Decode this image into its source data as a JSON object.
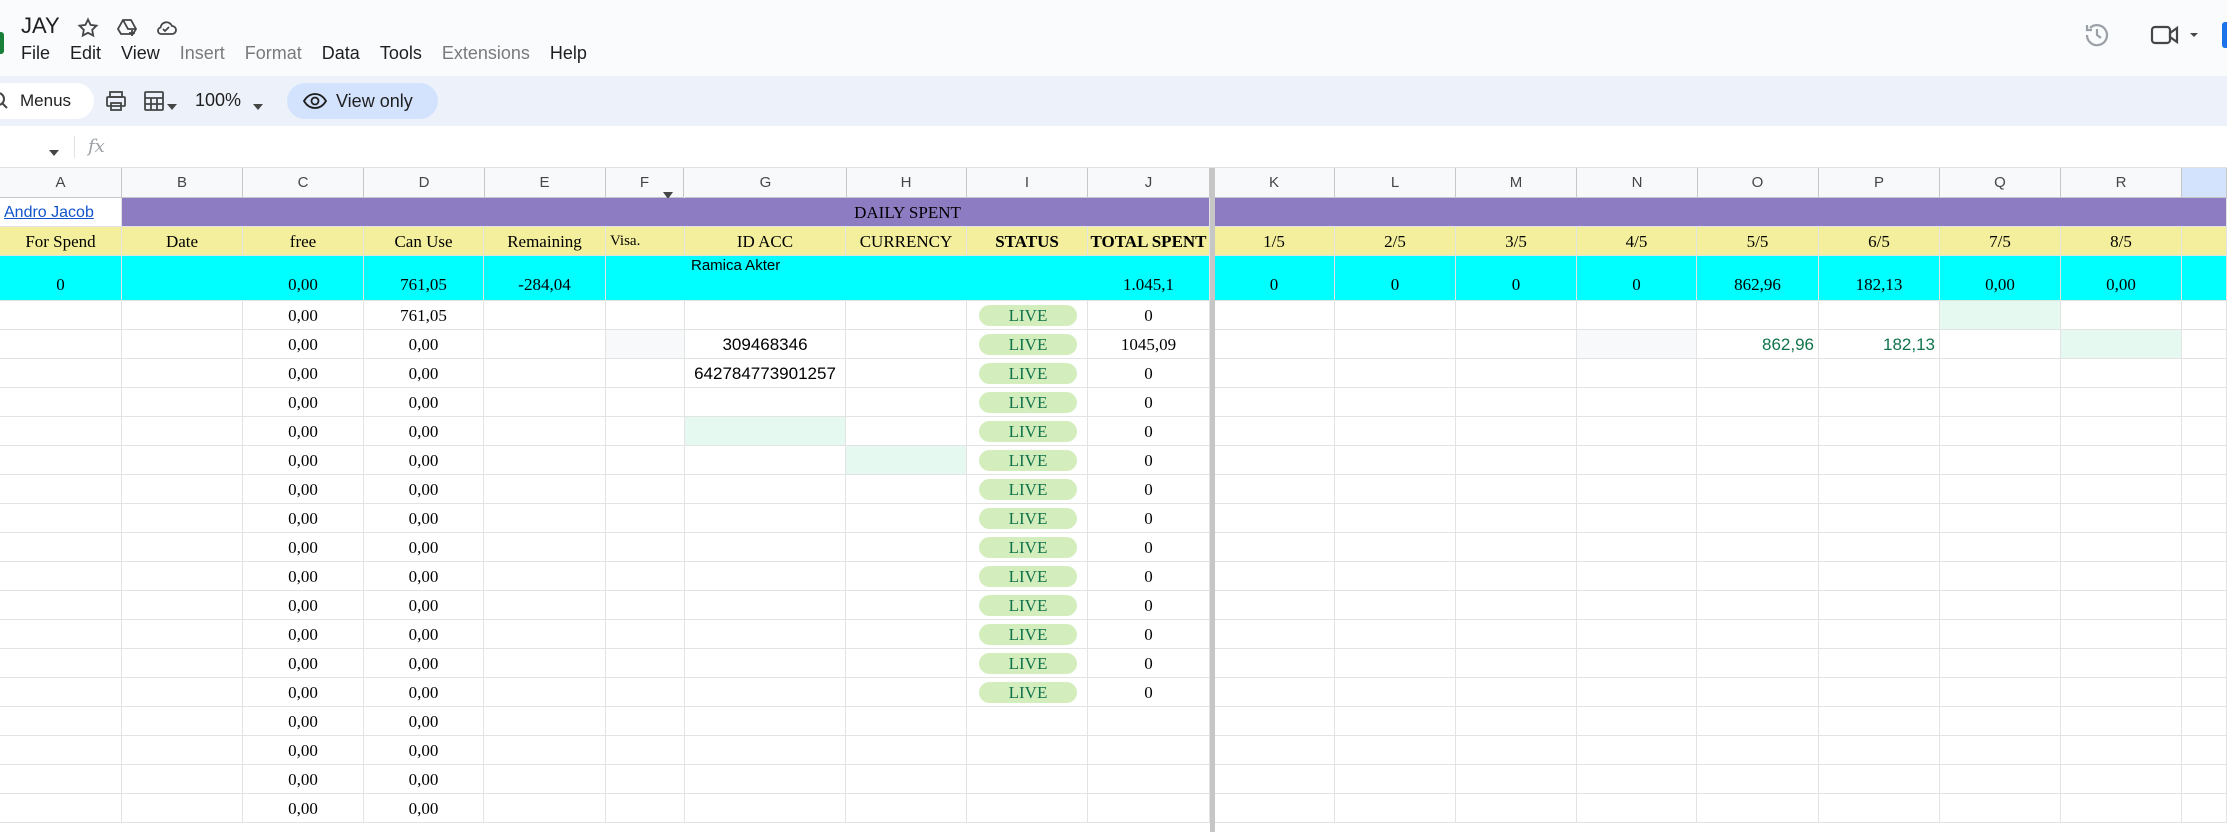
{
  "doc": {
    "title": "JAY"
  },
  "menu": [
    "File",
    "Edit",
    "View",
    "Insert",
    "Format",
    "Data",
    "Tools",
    "Extensions",
    "Help"
  ],
  "menu_disabled": [
    "Insert",
    "Format",
    "Extensions"
  ],
  "toolbar": {
    "menus_label": "Menus",
    "zoom": "100%",
    "view_only": "View only"
  },
  "formula_bar": {
    "fx": "fx"
  },
  "columns": [
    "A",
    "B",
    "C",
    "D",
    "E",
    "F",
    "G",
    "H",
    "I",
    "J",
    "K",
    "L",
    "M",
    "N",
    "O",
    "P",
    "Q",
    "R"
  ],
  "link_cell": "Andro Jacob",
  "banner_title": "DAILY SPENT",
  "headers": {
    "A": "For Spend",
    "B": "Date",
    "C": "free",
    "D": "Can Use",
    "E": "Remaining",
    "F": "Visa.",
    "G": "ID ACC",
    "H": "CURRENCY",
    "I": "STATUS",
    "J": "TOTAL SPENT",
    "K": "1/5",
    "L": "2/5",
    "M": "3/5",
    "N": "4/5",
    "O": "5/5",
    "P": "6/5",
    "Q": "7/5",
    "R": "8/5"
  },
  "summary": {
    "name_note": "Ramica Akter",
    "A": "0",
    "C": "0,00",
    "D": "761,05",
    "E": "-284,04",
    "J": "1.045,1",
    "K": "0",
    "L": "0",
    "M": "0",
    "N": "0",
    "O": "862,96",
    "P": "182,13",
    "Q": "0,00",
    "R": "0,00"
  },
  "rows": [
    {
      "C": "0,00",
      "D": "761,05",
      "G": "",
      "I": "LIVE",
      "J": "0"
    },
    {
      "C": "0,00",
      "D": "0,00",
      "G": "309468346",
      "I": "LIVE",
      "J": "1045,09",
      "O": "862,96",
      "P": "182,13"
    },
    {
      "C": "0,00",
      "D": "0,00",
      "G": "642784773901257",
      "I": "LIVE",
      "J": "0"
    },
    {
      "C": "0,00",
      "D": "0,00",
      "G": "",
      "I": "LIVE",
      "J": "0"
    },
    {
      "C": "0,00",
      "D": "0,00",
      "G": "",
      "I": "LIVE",
      "J": "0"
    },
    {
      "C": "0,00",
      "D": "0,00",
      "G": "",
      "I": "LIVE",
      "J": "0"
    },
    {
      "C": "0,00",
      "D": "0,00",
      "G": "",
      "I": "LIVE",
      "J": "0"
    },
    {
      "C": "0,00",
      "D": "0,00",
      "G": "",
      "I": "LIVE",
      "J": "0"
    },
    {
      "C": "0,00",
      "D": "0,00",
      "G": "",
      "I": "LIVE",
      "J": "0"
    },
    {
      "C": "0,00",
      "D": "0,00",
      "G": "",
      "I": "LIVE",
      "J": "0"
    },
    {
      "C": "0,00",
      "D": "0,00",
      "G": "",
      "I": "LIVE",
      "J": "0"
    },
    {
      "C": "0,00",
      "D": "0,00",
      "G": "",
      "I": "LIVE",
      "J": "0"
    },
    {
      "C": "0,00",
      "D": "0,00",
      "G": "",
      "I": "LIVE",
      "J": "0"
    },
    {
      "C": "0,00",
      "D": "0,00",
      "G": "",
      "I": "LIVE",
      "J": "0"
    },
    {
      "C": "0,00",
      "D": "0,00"
    },
    {
      "C": "0,00",
      "D": "0,00"
    },
    {
      "C": "0,00",
      "D": "0,00"
    },
    {
      "C": "0,00",
      "D": "0,00"
    }
  ],
  "colors": {
    "banner_purple": "#8e7cc3",
    "header_yellow": "#f4ef9c",
    "summary_cyan": "#00ffff",
    "live_pill": "#d4edbc",
    "live_text": "#11734b"
  },
  "icons": [
    "sheets-logo",
    "star-icon",
    "move-to-drive-icon",
    "cloud-status-icon",
    "version-history-icon",
    "meet-icon",
    "search-icon",
    "print-icon",
    "format-icon",
    "eye-icon",
    "fx-icon",
    "filter-icon"
  ]
}
